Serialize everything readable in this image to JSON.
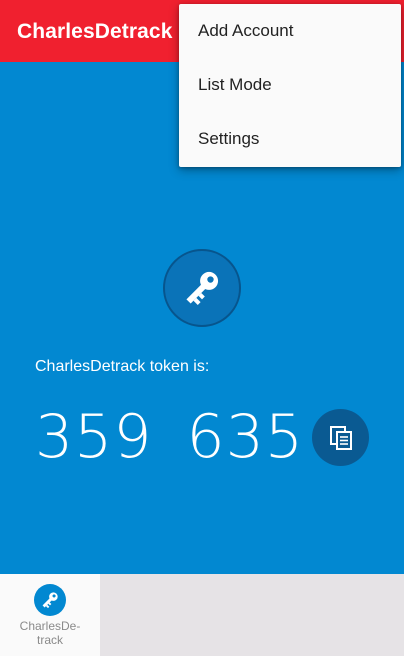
{
  "app_bar": {
    "title": "CharlesDetrack"
  },
  "menu": {
    "items": [
      {
        "label": "Add Account"
      },
      {
        "label": "List Mode"
      },
      {
        "label": "Settings"
      }
    ]
  },
  "token": {
    "label": "CharlesDetrack token is:",
    "part1": "359",
    "part2": "635"
  },
  "bottom_tabs": [
    {
      "label": "CharlesDe-\ntrack",
      "icon": "key-icon"
    }
  ],
  "colors": {
    "app_bar": "#f0202f",
    "main_bg": "#0288d1",
    "accent_dark": "#0a5a92"
  }
}
